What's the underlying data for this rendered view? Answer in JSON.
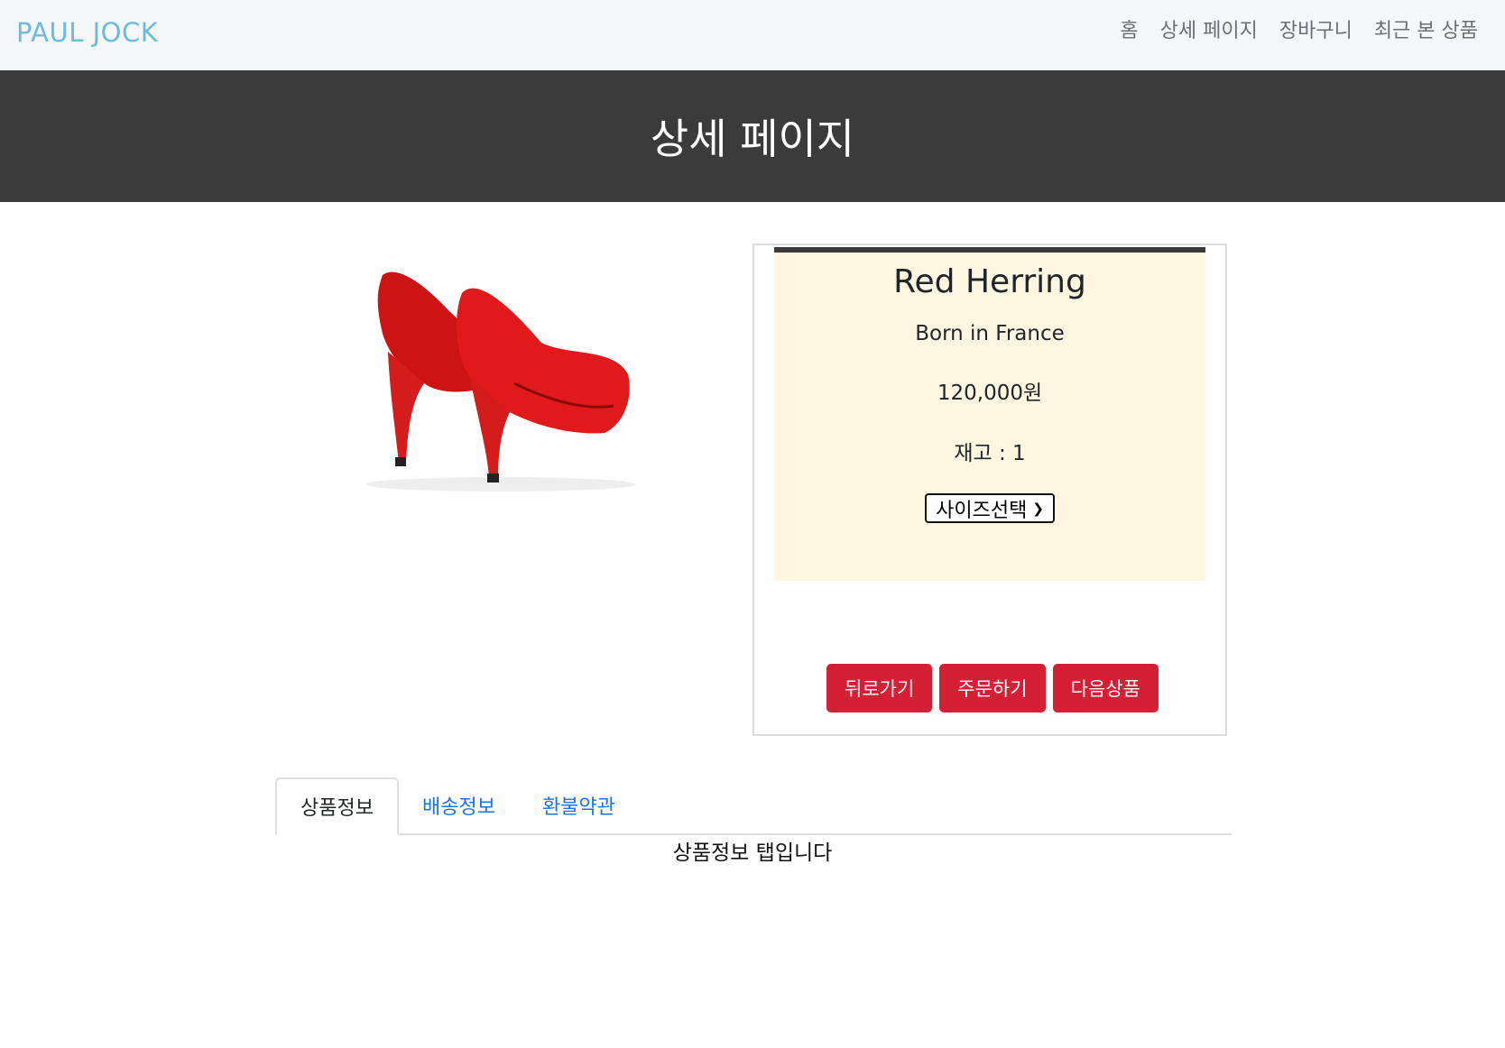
{
  "navbar": {
    "brand": "PAUL JOCK",
    "links": [
      "홈",
      "상세 페이지",
      "장바구니",
      "최근 본 상품"
    ]
  },
  "banner": {
    "title": "상세 페이지"
  },
  "product": {
    "image_icon": "red-high-heels-image",
    "name": "Red Herring",
    "origin": "Born in France",
    "price": "120,000원",
    "stock": "재고 : 1",
    "size_select": {
      "selected": "사이즈선택",
      "icon": "chevron-down-icon"
    },
    "buttons": {
      "back": "뒤로가기",
      "order": "주문하기",
      "next": "다음상품"
    }
  },
  "tabs": {
    "items": [
      "상품정보",
      "배송정보",
      "환불약관"
    ],
    "active_index": 0,
    "content": "상품정보 탭입니다"
  },
  "colors": {
    "brand": "#6bbbe0",
    "banner_bg": "#3c3b3c",
    "info_bg": "#fff6e2",
    "button": "#d51f35",
    "tab_link": "#1a73e8"
  }
}
